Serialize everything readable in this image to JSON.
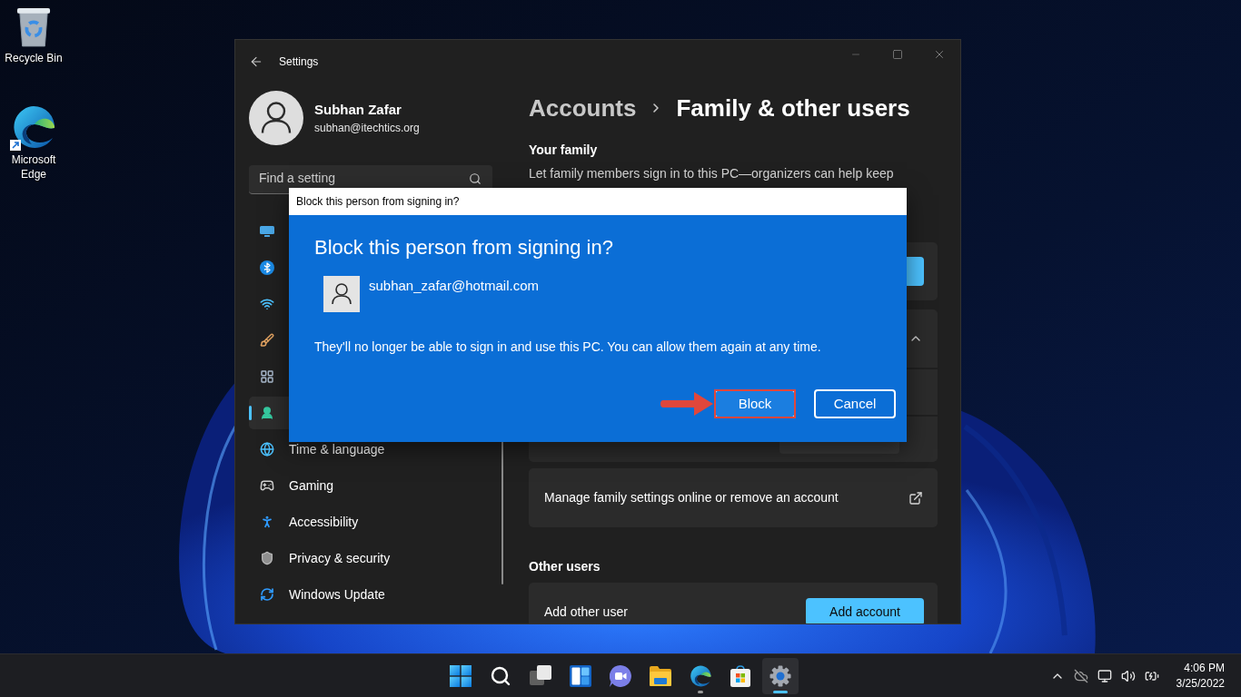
{
  "desktop_icons": [
    {
      "label": "Recycle Bin",
      "shortcut": false
    },
    {
      "label": "Microsoft Edge",
      "shortcut": true
    }
  ],
  "settings": {
    "title": "Settings",
    "profile": {
      "name": "Subhan Zafar",
      "email": "subhan@itechtics.org"
    },
    "search": {
      "placeholder": "Find a setting"
    },
    "nav": [
      {
        "selected": false
      },
      {
        "selected": false
      },
      {
        "selected": false
      },
      {
        "selected": false
      },
      {
        "selected": false
      },
      {
        "selected": true
      },
      {
        "label": "Time & language",
        "selected": false
      },
      {
        "label": "Gaming",
        "selected": false
      },
      {
        "label": "Accessibility",
        "selected": false
      },
      {
        "label": "Privacy & security",
        "selected": false
      },
      {
        "label": "Windows Update",
        "selected": false
      }
    ],
    "breadcrumb": {
      "parent": "Accounts",
      "current": "Family & other users"
    },
    "your_family": {
      "heading": "Your family",
      "description": "Let family members sign in to this PC—organizers can help keep"
    },
    "family_member": {
      "expanded": true
    },
    "manage_link": {
      "label": "Manage family settings online or remove an account"
    },
    "other_users": {
      "heading": "Other users",
      "add_row": {
        "label": "Add other user",
        "button": "Add account"
      }
    }
  },
  "dialog": {
    "title": "Block this person from signing in?",
    "heading": "Block this person from signing in?",
    "account": "subhan_zafar@hotmail.com",
    "message": "They'll no longer be able to sign in and use this PC. You can allow them again at any time.",
    "buttons": [
      {
        "label": "Block",
        "default": true,
        "highlighted": true
      },
      {
        "label": "Cancel",
        "default": false,
        "highlighted": false
      }
    ]
  },
  "taskbar": {
    "apps": [
      {
        "selected": false,
        "running": false
      },
      {
        "selected": false,
        "running": false
      },
      {
        "selected": false,
        "running": false
      },
      {
        "selected": false,
        "running": false
      },
      {
        "selected": false,
        "running": false
      },
      {
        "selected": false,
        "running": false
      },
      {
        "selected": false,
        "running": true
      },
      {
        "selected": false,
        "running": false
      },
      {
        "selected": true,
        "running": true
      }
    ],
    "clock": {
      "time": "4:06 PM",
      "date": "3/25/2022"
    }
  }
}
